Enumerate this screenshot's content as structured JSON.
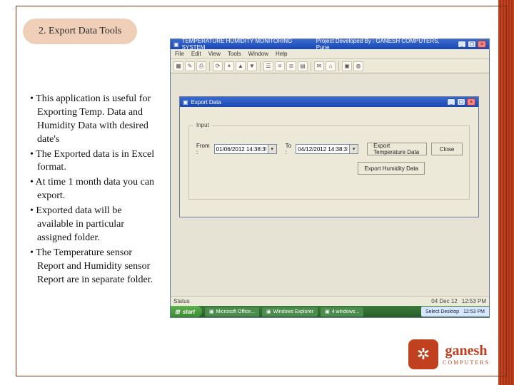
{
  "slide": {
    "title": "2. Export Data Tools",
    "bullets": [
      "This application is useful for Exporting Temp. Data and Humidity Data with desired date's",
      "The Exported data is in Excel format.",
      "At time 1 month data you can export.",
      "Exported data will be available in particular assigned folder.",
      "The Temperature sensor Report and Humidity sensor Report are  in separate folder."
    ]
  },
  "mainWindow": {
    "titleLeft": "TEMPERATURE HUMIDITY MONITORING SYSTEM",
    "titleRight": "Project Developed By : GANESH COMPUTERS, Pune",
    "menu": [
      "File",
      "Edit",
      "View",
      "Tools",
      "Window",
      "Help"
    ]
  },
  "exportDialog": {
    "title": "Export Data",
    "groupLabel": "Input",
    "fromLabel": "From :",
    "toLabel": "To :",
    "fromValue": "01/06/2012 14:38:35",
    "toValue": "04/12/2012 14:38:35",
    "btnExportTemp": "Export Temperature Data",
    "btnExportHum": "Export Humidity Data",
    "btnClose": "Close"
  },
  "statusbar": {
    "label": "Status",
    "date": "04 Dec 12",
    "time": "12:53 PM"
  },
  "taskbar": {
    "start": "start",
    "tasks": [
      "Microsoft Office...",
      "Windows Explorer",
      "4 windows..."
    ],
    "trayLabel": "Select Desktop",
    "trayTime": "12:53 PM"
  },
  "logo": {
    "name": "ganesh",
    "sub": "COMPUTERS"
  }
}
